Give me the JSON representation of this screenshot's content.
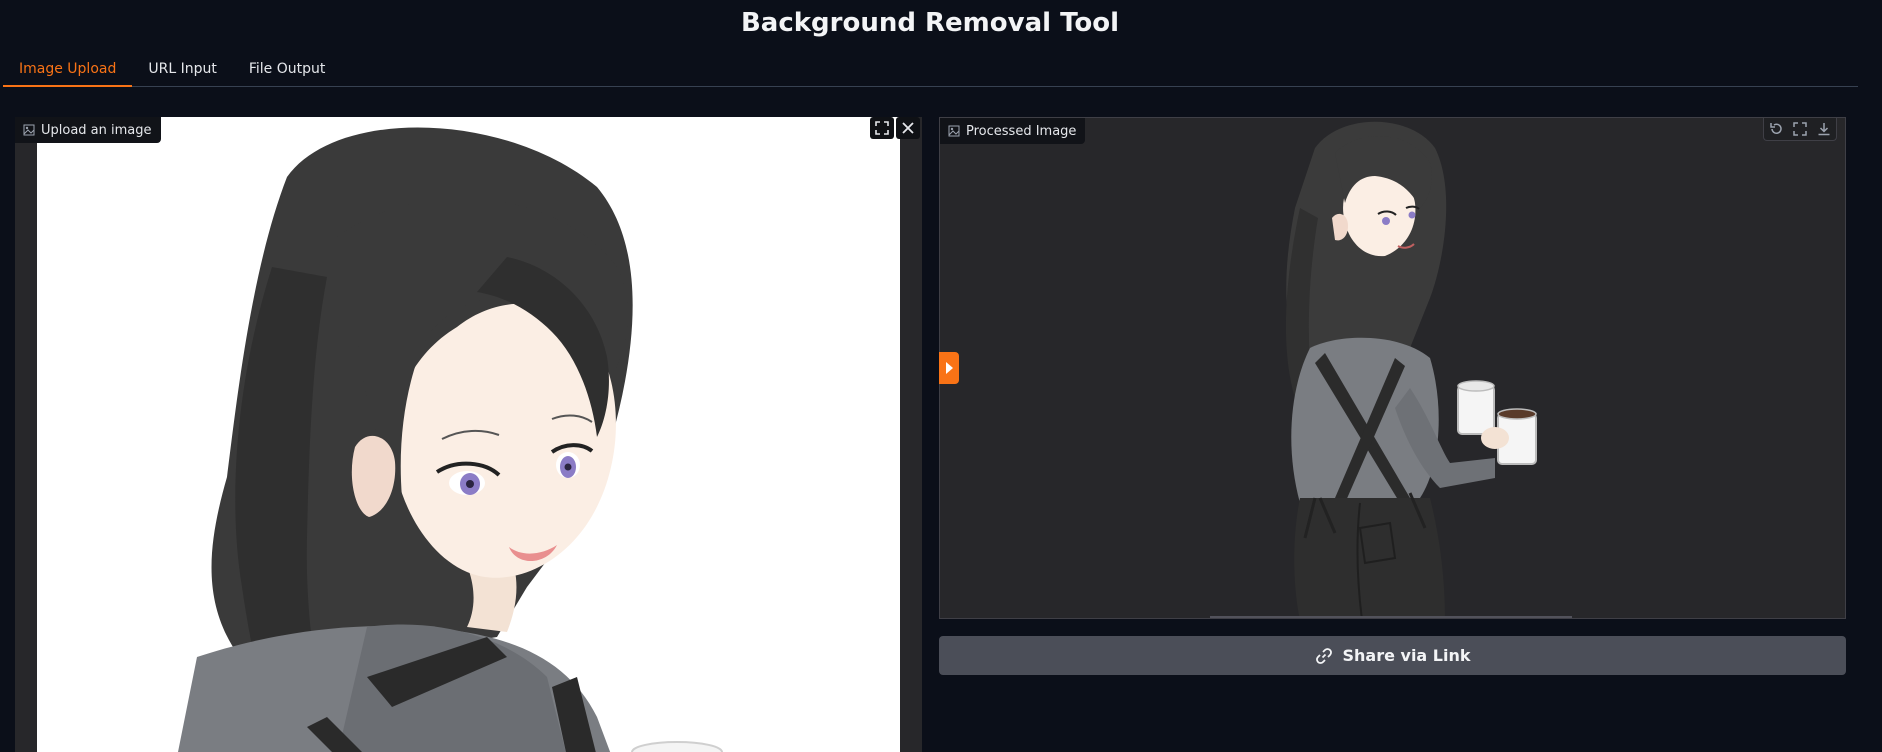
{
  "app": {
    "title": "Background Removal Tool"
  },
  "tabs": [
    {
      "label": "Image Upload",
      "active": true
    },
    {
      "label": "URL Input",
      "active": false
    },
    {
      "label": "File Output",
      "active": false
    }
  ],
  "input_panel": {
    "label": "Upload an image",
    "label_icon": "image-icon",
    "tools": [
      "fullscreen-icon",
      "close-icon"
    ]
  },
  "output_panel": {
    "label": "Processed Image",
    "label_icon": "image-icon",
    "tools": [
      "undo-icon",
      "fullscreen-icon",
      "download-icon"
    ]
  },
  "share": {
    "label": "Share via Link",
    "icon": "link-icon"
  },
  "colors": {
    "accent": "#f97316",
    "background": "#0b0f19",
    "panel": "#27272a",
    "button": "#4b4e58"
  }
}
